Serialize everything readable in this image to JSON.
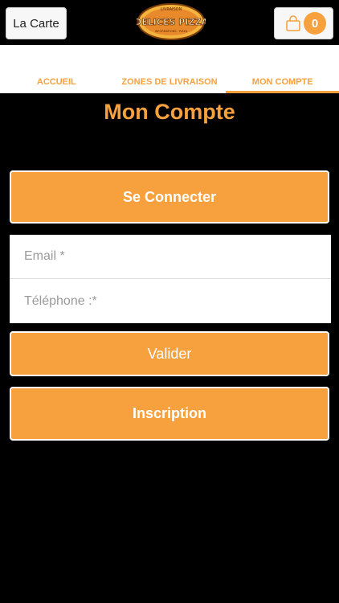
{
  "header": {
    "menu_label": "La Carte",
    "logo_text": "DELICES PIZZA",
    "cart_count": "0"
  },
  "tabs": [
    {
      "label": "ACCUEIL"
    },
    {
      "label": "ZONES DE LIVRAISON"
    },
    {
      "label": "MON COMPTE"
    }
  ],
  "page": {
    "title": "Mon Compte",
    "connect_label": "Se Connecter",
    "email_placeholder": "Email *",
    "phone_placeholder": "Téléphone :*",
    "validate_label": "Valider",
    "signup_label": "Inscription"
  },
  "colors": {
    "accent": "#f7a13e",
    "background": "#000000"
  }
}
